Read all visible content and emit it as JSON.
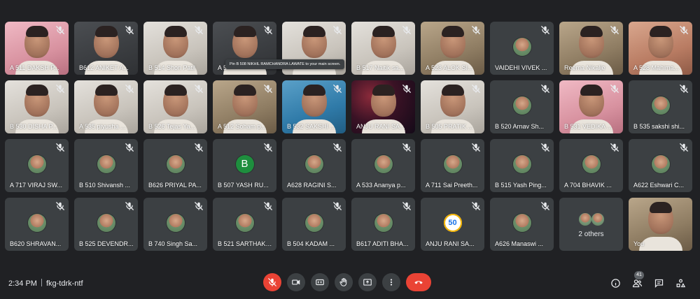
{
  "tiles": [
    {
      "name": "A 511 DAKSH P...",
      "kind": "video",
      "style": "pink"
    },
    {
      "name": "B612 ANIKET A...",
      "kind": "video",
      "style": "dark"
    },
    {
      "name": "B 514 Shon Patil",
      "kind": "video",
      "style": "light"
    },
    {
      "name": "A 5",
      "kind": "video",
      "style": "dark"
    },
    {
      "name": "",
      "kind": "video",
      "style": "light"
    },
    {
      "name": "B 517 Naitik sa...",
      "kind": "video",
      "style": "light"
    },
    {
      "name": "A 523 ALOK SI...",
      "kind": "video",
      "style": "room"
    },
    {
      "name": "VAIDEHI VIVEK ...",
      "kind": "avatar"
    },
    {
      "name": "Reema Nikalje",
      "kind": "video",
      "style": "room"
    },
    {
      "name": "A 528 Mahima...",
      "kind": "video",
      "style": "warm"
    },
    {
      "name": "B 530 DISHA P...",
      "kind": "video",
      "style": "light"
    },
    {
      "name": "A 535 piyusha ...",
      "kind": "video",
      "style": "light"
    },
    {
      "name": "B 526 Tejas Ya...",
      "kind": "video",
      "style": "light"
    },
    {
      "name": "A 512 Soham p...",
      "kind": "video",
      "style": "room"
    },
    {
      "name": "B 532 SAKSHI ...",
      "kind": "video",
      "style": "blue"
    },
    {
      "name": "ANJU RANI SA...",
      "kind": "video",
      "style": "space"
    },
    {
      "name": "B 505 PRATIK ...",
      "kind": "video",
      "style": "light"
    },
    {
      "name": "B 520 Arnav Sh...",
      "kind": "avatar"
    },
    {
      "name": "B 531 VEDIKA ...",
      "kind": "video",
      "style": "pink"
    },
    {
      "name": "B 535 sakshi shi...",
      "kind": "avatar"
    },
    {
      "name": "A 717 VIRAJ SW...",
      "kind": "avatar"
    },
    {
      "name": "B 510 Shivansh ...",
      "kind": "avatar"
    },
    {
      "name": "B626 PRIYAL PA...",
      "kind": "avatar"
    },
    {
      "name": "B 507 YASH RU...",
      "kind": "letter",
      "letter": "B"
    },
    {
      "name": "A628 RAGINI S...",
      "kind": "avatar"
    },
    {
      "name": "A 533 Ananya p...",
      "kind": "avatar"
    },
    {
      "name": "A 711 Sai Preeth...",
      "kind": "avatar"
    },
    {
      "name": "B 515 Yash Ping...",
      "kind": "avatar"
    },
    {
      "name": "A 704 BHAVIK ...",
      "kind": "avatar"
    },
    {
      "name": "A622 Eshwari C...",
      "kind": "avatar"
    },
    {
      "name": "B620 SHRAVAN...",
      "kind": "avatar"
    },
    {
      "name": "B 525 DEVENDR...",
      "kind": "avatar"
    },
    {
      "name": "B 740 Singh Sa...",
      "kind": "avatar"
    },
    {
      "name": "B 521 SARTHAK ...",
      "kind": "avatar"
    },
    {
      "name": "B 504 KADAM ...",
      "kind": "avatar"
    },
    {
      "name": "B617 ADITI BHA...",
      "kind": "avatar"
    },
    {
      "name": "ANJU RANI SA...",
      "kind": "fifty",
      "letter": "50"
    },
    {
      "name": "A626 Manaswi ...",
      "kind": "avatar"
    },
    {
      "name": "2 others",
      "kind": "others"
    },
    {
      "name": "You",
      "kind": "self"
    }
  ],
  "tooltip": "Pin B 508 NIKHIL RAMCHANDRA LAWATE to your main screen.",
  "bottom_bar": {
    "time": "2:34 PM",
    "meeting_code": "fkg-tdrk-ntf",
    "participant_count": "41"
  },
  "colors": {
    "background": "#202124",
    "tile": "#3c4043",
    "hangup_red": "#ea4335"
  }
}
